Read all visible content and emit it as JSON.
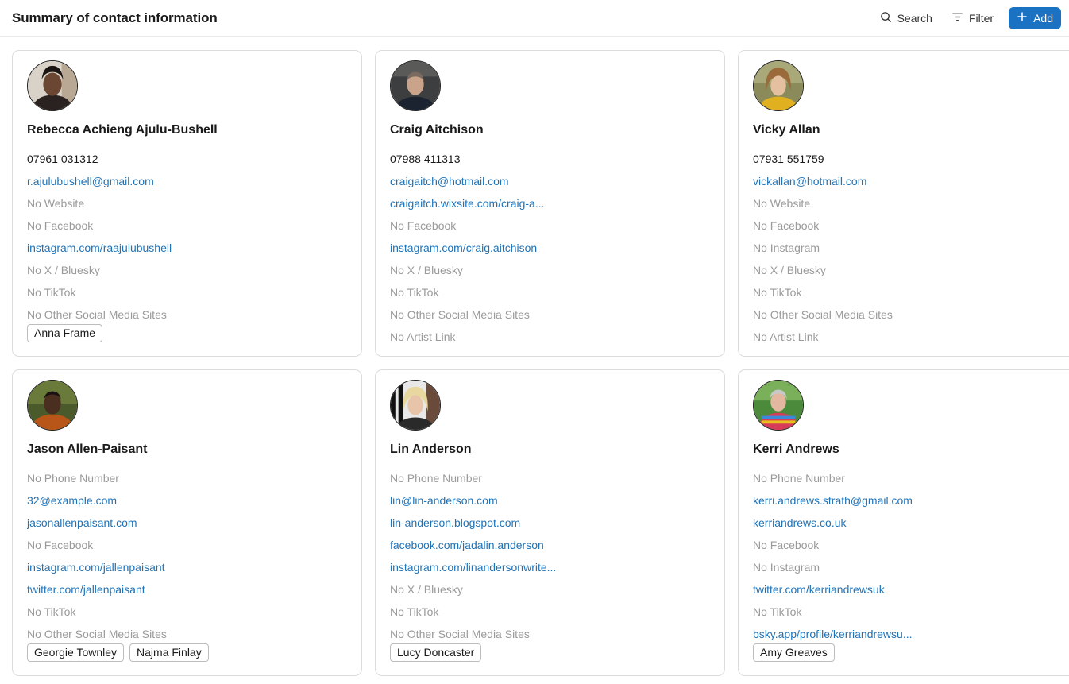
{
  "header": {
    "title": "Summary of contact information",
    "search_label": "Search",
    "filter_label": "Filter",
    "add_label": "Add"
  },
  "colors": {
    "accent": "#1c72c2",
    "link": "#1f73b7",
    "muted": "#9a9a9a"
  },
  "cards": [
    {
      "name": "Rebecca Achieng Ajulu-Bushell",
      "fields": [
        {
          "text": "07961 031312",
          "kind": "text"
        },
        {
          "text": "r.ajulubushell@gmail.com",
          "kind": "link"
        },
        {
          "text": "No Website",
          "kind": "empty"
        },
        {
          "text": "No Facebook",
          "kind": "empty"
        },
        {
          "text": "instagram.com/raajulubushell",
          "kind": "link"
        },
        {
          "text": "No X / Bluesky",
          "kind": "empty"
        },
        {
          "text": "No TikTok",
          "kind": "empty"
        },
        {
          "text": "No Other Social Media Sites",
          "kind": "empty"
        }
      ],
      "tags": [
        "Anna Frame"
      ]
    },
    {
      "name": "Craig Aitchison",
      "fields": [
        {
          "text": "07988 411313",
          "kind": "text"
        },
        {
          "text": "craigaitch@hotmail.com",
          "kind": "link"
        },
        {
          "text": "craigaitch.wixsite.com/craig-a...",
          "kind": "link"
        },
        {
          "text": "No Facebook",
          "kind": "empty"
        },
        {
          "text": "instagram.com/craig.aitchison",
          "kind": "link"
        },
        {
          "text": "No X / Bluesky",
          "kind": "empty"
        },
        {
          "text": "No TikTok",
          "kind": "empty"
        },
        {
          "text": "No Other Social Media Sites",
          "kind": "empty"
        },
        {
          "text": "No Artist Link",
          "kind": "empty"
        }
      ],
      "tags": []
    },
    {
      "name": "Vicky Allan",
      "fields": [
        {
          "text": "07931 551759",
          "kind": "text"
        },
        {
          "text": "vickallan@hotmail.com",
          "kind": "link"
        },
        {
          "text": "No Website",
          "kind": "empty"
        },
        {
          "text": "No Facebook",
          "kind": "empty"
        },
        {
          "text": "No Instagram",
          "kind": "empty"
        },
        {
          "text": "No X / Bluesky",
          "kind": "empty"
        },
        {
          "text": "No TikTok",
          "kind": "empty"
        },
        {
          "text": "No Other Social Media Sites",
          "kind": "empty"
        },
        {
          "text": "No Artist Link",
          "kind": "empty"
        }
      ],
      "tags": []
    },
    {
      "name": "Jason Allen-Paisant",
      "fields": [
        {
          "text": "No Phone Number",
          "kind": "empty"
        },
        {
          "text": "32@example.com",
          "kind": "link"
        },
        {
          "text": "jasonallenpaisant.com",
          "kind": "link"
        },
        {
          "text": "No Facebook",
          "kind": "empty"
        },
        {
          "text": "instagram.com/jallenpaisant",
          "kind": "link"
        },
        {
          "text": "twitter.com/jallenpaisant",
          "kind": "link"
        },
        {
          "text": "No TikTok",
          "kind": "empty"
        },
        {
          "text": "No Other Social Media Sites",
          "kind": "empty"
        }
      ],
      "tags": [
        "Georgie Townley",
        "Najma Finlay"
      ]
    },
    {
      "name": "Lin Anderson",
      "fields": [
        {
          "text": "No Phone Number",
          "kind": "empty"
        },
        {
          "text": "lin@lin-anderson.com",
          "kind": "link"
        },
        {
          "text": "lin-anderson.blogspot.com",
          "kind": "link"
        },
        {
          "text": "facebook.com/jadalin.anderson",
          "kind": "link"
        },
        {
          "text": "instagram.com/linandersonwrite...",
          "kind": "link"
        },
        {
          "text": "No X / Bluesky",
          "kind": "empty"
        },
        {
          "text": "No TikTok",
          "kind": "empty"
        },
        {
          "text": "No Other Social Media Sites",
          "kind": "empty"
        }
      ],
      "tags": [
        "Lucy Doncaster"
      ]
    },
    {
      "name": "Kerri Andrews",
      "fields": [
        {
          "text": "No Phone Number",
          "kind": "empty"
        },
        {
          "text": "kerri.andrews.strath@gmail.com",
          "kind": "link"
        },
        {
          "text": "kerriandrews.co.uk",
          "kind": "link"
        },
        {
          "text": "No Facebook",
          "kind": "empty"
        },
        {
          "text": "No Instagram",
          "kind": "empty"
        },
        {
          "text": "twitter.com/kerriandrewsuk",
          "kind": "link"
        },
        {
          "text": "No TikTok",
          "kind": "empty"
        },
        {
          "text": "bsky.app/profile/kerriandrewsu...",
          "kind": "link"
        }
      ],
      "tags": [
        "Amy Greaves"
      ]
    }
  ]
}
